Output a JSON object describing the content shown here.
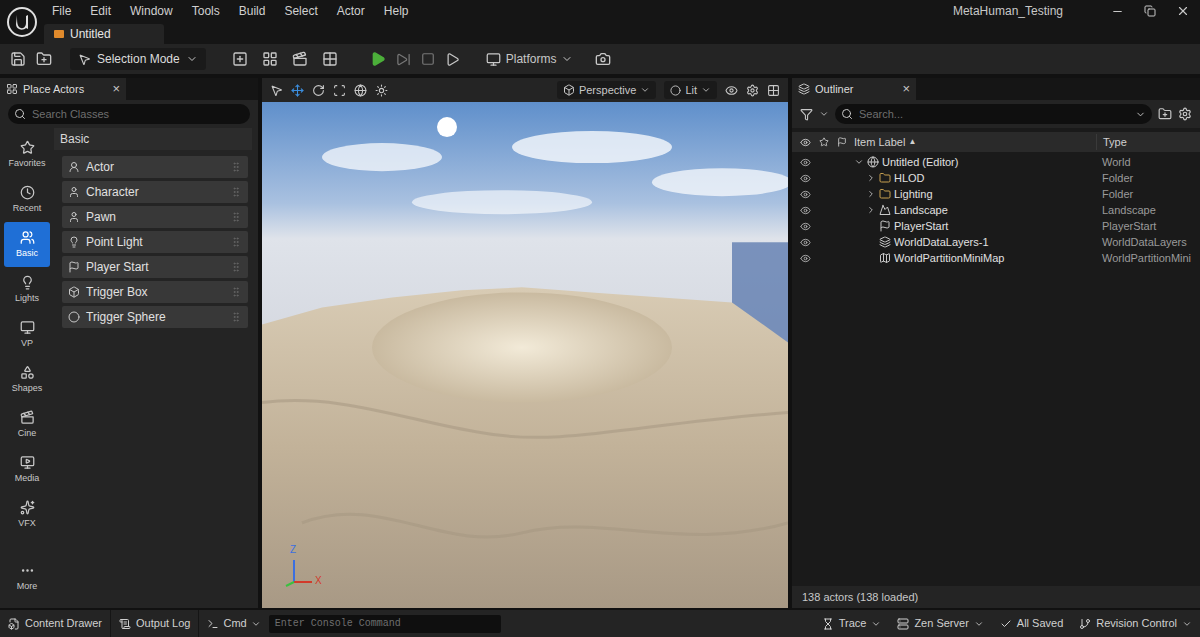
{
  "app": {
    "menu": [
      "File",
      "Edit",
      "Window",
      "Tools",
      "Build",
      "Select",
      "Actor",
      "Help"
    ],
    "project": "MetaHuman_Testing",
    "document_tab": "Untitled"
  },
  "toolbar": {
    "mode": "Selection Mode",
    "platforms": "Platforms"
  },
  "place_actors": {
    "title": "Place Actors",
    "close": "×",
    "search_placeholder": "Search Classes",
    "categories": [
      {
        "label": "Favorites",
        "selected": false
      },
      {
        "label": "Recent",
        "selected": false
      },
      {
        "label": "Basic",
        "selected": true
      },
      {
        "label": "Lights",
        "selected": false
      },
      {
        "label": "VP",
        "selected": false
      },
      {
        "label": "Shapes",
        "selected": false
      },
      {
        "label": "Cine",
        "selected": false
      },
      {
        "label": "Media",
        "selected": false
      },
      {
        "label": "VFX",
        "selected": false
      },
      {
        "label": "More",
        "selected": false
      }
    ],
    "section": "Basic",
    "items": [
      "Actor",
      "Character",
      "Pawn",
      "Point Light",
      "Player Start",
      "Trigger Box",
      "Trigger Sphere"
    ]
  },
  "viewport": {
    "view_mode": "Perspective",
    "lighting": "Lit",
    "axes": [
      "Z",
      "X"
    ]
  },
  "outliner": {
    "title": "Outliner",
    "close": "×",
    "search_placeholder": "Search...",
    "columns": [
      {
        "label": "Item Label",
        "sort": "▲"
      },
      {
        "label": "Type",
        "sort": ""
      }
    ],
    "rows": [
      {
        "label": "Untitled (Editor)",
        "type": "World",
        "kind": "world",
        "depth": 0,
        "expandable": true,
        "expanded": true
      },
      {
        "label": "HLOD",
        "type": "Folder",
        "kind": "folder",
        "depth": 1,
        "expandable": true,
        "expanded": false
      },
      {
        "label": "Lighting",
        "type": "Folder",
        "kind": "folder",
        "depth": 1,
        "expandable": true,
        "expanded": false
      },
      {
        "label": "Landscape",
        "type": "Landscape",
        "kind": "landscape",
        "depth": 1,
        "expandable": true,
        "expanded": false
      },
      {
        "label": "PlayerStart",
        "type": "PlayerStart",
        "kind": "player_start",
        "depth": 1,
        "expandable": false,
        "expanded": false
      },
      {
        "label": "WorldDataLayers-1",
        "type": "WorldDataLayers",
        "kind": "data_layers",
        "depth": 1,
        "expandable": false,
        "expanded": false
      },
      {
        "label": "WorldPartitionMiniMap",
        "type": "WorldPartitionMini",
        "kind": "minimap",
        "depth": 1,
        "expandable": false,
        "expanded": false
      }
    ],
    "footer": "138 actors (138 loaded)"
  },
  "status_bar": {
    "left": [
      "Content Drawer",
      "Output Log"
    ],
    "cmd": "Cmd",
    "console_placeholder": "Enter Console Command",
    "right": [
      "Trace",
      "Zen Server",
      "All Saved",
      "Revision Control"
    ]
  }
}
